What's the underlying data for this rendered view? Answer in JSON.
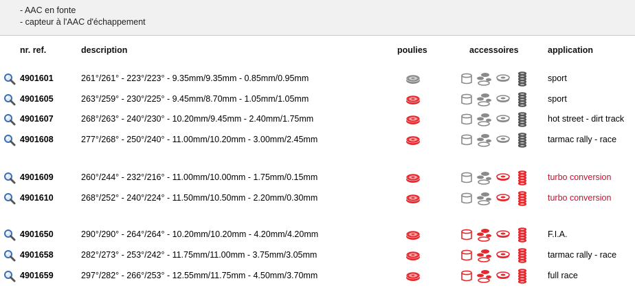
{
  "notes": [
    "- AAC en fonte",
    "- capteur à l'AAC d'échappement"
  ],
  "headers": {
    "ref": "nr. ref.",
    "description": "description",
    "poulies": "poulies",
    "accessoires": "accessoires",
    "application": "application"
  },
  "colors": {
    "red": "#e8262c",
    "grey": "#8a8a8a",
    "red_text": "#c8102e"
  },
  "rows": [
    {
      "ref": "4901601",
      "desc": "261°/261° - 223°/223° - 9.35mm/9.35mm - 0.85mm/0.95mm",
      "pulley": "grey",
      "acc": [
        "grey",
        "grey",
        "grey",
        "dark"
      ],
      "app": "sport",
      "app_red": false
    },
    {
      "ref": "4901605",
      "desc": "263°/259° - 230°/225° - 9.45mm/8.70mm - 1.05mm/1.05mm",
      "pulley": "red",
      "acc": [
        "grey",
        "grey",
        "grey",
        "dark"
      ],
      "app": "sport",
      "app_red": false
    },
    {
      "ref": "4901607",
      "desc": "268°/263° - 240°/230° - 10.20mm/9.45mm - 2.40mm/1.75mm",
      "pulley": "red",
      "acc": [
        "grey",
        "grey",
        "grey",
        "dark"
      ],
      "app": "hot street - dirt track",
      "app_red": false
    },
    {
      "ref": "4901608",
      "desc": "277°/268° - 250°/240° - 11.00mm/10.20mm - 3.00mm/2.45mm",
      "pulley": "red",
      "acc": [
        "grey",
        "grey",
        "grey",
        "dark"
      ],
      "app": "tarmac rally - race",
      "app_red": false
    },
    {
      "ref": "4901609",
      "desc": "260°/244° - 232°/216° - 11.00mm/10.00mm - 1.75mm/0.15mm",
      "pulley": "red",
      "acc": [
        "grey",
        "grey",
        "red",
        "red"
      ],
      "app": "turbo conversion",
      "app_red": true
    },
    {
      "ref": "4901610",
      "desc": "268°/252° - 240°/224° - 11.50mm/10.50mm - 2.20mm/0.30mm",
      "pulley": "red",
      "acc": [
        "grey",
        "grey",
        "red",
        "red"
      ],
      "app": "turbo conversion",
      "app_red": true
    },
    {
      "ref": "4901650",
      "desc": "290°/290° - 264°/264° - 10.20mm/10.20mm - 4.20mm/4.20mm",
      "pulley": "red",
      "acc": [
        "red",
        "red",
        "red",
        "red"
      ],
      "app": "F.I.A.",
      "app_red": false
    },
    {
      "ref": "4901658",
      "desc": "282°/273° - 253°/242° - 11.75mm/11.00mm - 3.75mm/3.05mm",
      "pulley": "red",
      "acc": [
        "red",
        "red",
        "red",
        "red"
      ],
      "app": "tarmac rally - race",
      "app_red": false
    },
    {
      "ref": "4901659",
      "desc": "297°/282° - 266°/253° - 12.55mm/11.75mm - 4.50mm/3.70mm",
      "pulley": "red",
      "acc": [
        "red",
        "red",
        "red",
        "red"
      ],
      "app": "full race",
      "app_red": false
    }
  ]
}
